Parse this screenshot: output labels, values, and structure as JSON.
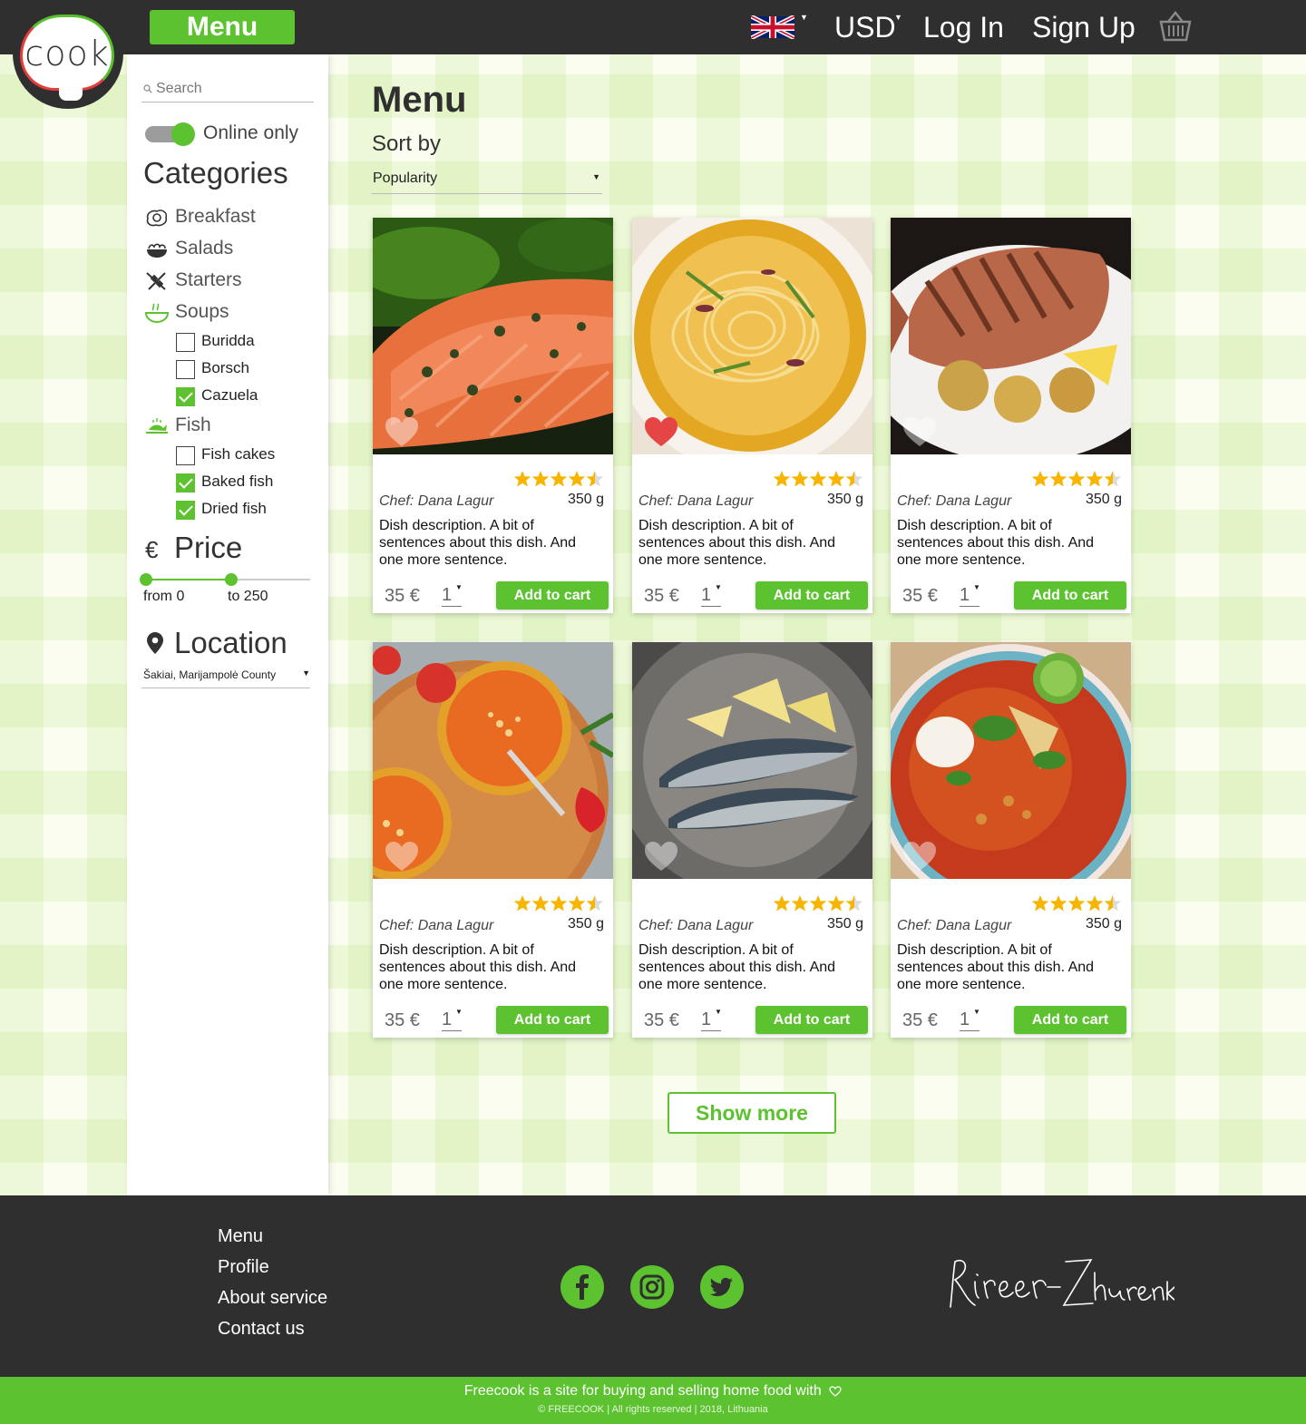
{
  "header": {
    "logo_text": "cook",
    "menu_label": "Menu",
    "language": "English (UK flag)",
    "currency": "USD",
    "login": "Log In",
    "signup": "Sign Up"
  },
  "sidebar": {
    "search_placeholder": "Search",
    "online_only": "Online only",
    "online_only_on": true,
    "categories_title": "Categories",
    "categories": [
      {
        "label": "Breakfast",
        "icon": "fried-egg-icon"
      },
      {
        "label": "Salads",
        "icon": "salad-bowl-icon"
      },
      {
        "label": "Starters",
        "icon": "skewer-icon"
      },
      {
        "label": "Soups",
        "icon": "soup-bowl-icon",
        "active": true
      },
      {
        "label": "Fish",
        "icon": "fish-plate-icon",
        "active": true
      }
    ],
    "soups": [
      {
        "label": "Buridda",
        "checked": false
      },
      {
        "label": "Borsch",
        "checked": false
      },
      {
        "label": "Cazuela",
        "checked": true
      }
    ],
    "fish": [
      {
        "label": "Fish cakes",
        "checked": false
      },
      {
        "label": "Baked fish",
        "checked": true
      },
      {
        "label": "Dried fish",
        "checked": true
      }
    ],
    "price_title": "Price",
    "price_symbol": "€",
    "price_from": "from 0",
    "price_to": "to 250",
    "location_title": "Location",
    "location_value": "Šakiai,  Marijampolė County"
  },
  "main": {
    "title": "Menu",
    "sort_label": "Sort by",
    "sort_value": "Popularity",
    "cards": [
      {
        "image": "salmon-fillet",
        "favorite": false,
        "rating": 4.5,
        "chef": "Chef: Dana Lagur",
        "weight": "350 g",
        "description": "Dish description. A bit of sentences about this dish. And one more sentence.",
        "price": "35 €",
        "qty": "1",
        "button": "Add to cart"
      },
      {
        "image": "noodle-soup",
        "favorite": true,
        "rating": 4.5,
        "chef": "Chef: Dana Lagur",
        "weight": "350 g",
        "description": "Dish description. A bit of sentences about this dish. And one more sentence.",
        "price": "35 €",
        "qty": "1",
        "button": "Add to cart"
      },
      {
        "image": "grilled-fish",
        "favorite": false,
        "rating": 4.5,
        "chef": "Chef: Dana Lagur",
        "weight": "350 g",
        "description": "Dish description. A bit of sentences about this dish. And one more sentence.",
        "price": "35 €",
        "qty": "1",
        "button": "Add to cart"
      },
      {
        "image": "tomato-soup",
        "favorite": false,
        "rating": 4.5,
        "chef": "Chef: Dana Lagur",
        "weight": "350 g",
        "description": "Dish description. A bit of sentences about this dish. And one more sentence.",
        "price": "35 €",
        "qty": "1",
        "button": "Add to cart"
      },
      {
        "image": "sardines",
        "favorite": false,
        "rating": 4.5,
        "chef": "Chef: Dana Lagur",
        "weight": "350 g",
        "description": "Dish description. A bit of sentences about this dish. And one more sentence.",
        "price": "35 €",
        "qty": "1",
        "button": "Add to cart"
      },
      {
        "image": "tortilla-soup",
        "favorite": false,
        "rating": 4.5,
        "chef": "Chef: Dana Lagur",
        "weight": "350 g",
        "description": "Dish description. A bit of sentences about this dish. And one more sentence.",
        "price": "35 €",
        "qty": "1",
        "button": "Add to cart"
      }
    ],
    "show_more": "Show more"
  },
  "footer": {
    "links": [
      "Menu",
      "Profile",
      "About service",
      "Contact us"
    ],
    "social": [
      "facebook-icon",
      "instagram-icon",
      "twitter-icon"
    ],
    "signature_text": "Kireev-Zhurenko",
    "tagline": "Freecook is a site for buying and selling home food with",
    "copyright": "© FREECOOK | All rights reserved | 2018, Lithuania"
  },
  "colors": {
    "accent": "#5cc22f",
    "dark": "#2f2f2f",
    "star": "#f7b500",
    "heart_active": "#e64545"
  }
}
